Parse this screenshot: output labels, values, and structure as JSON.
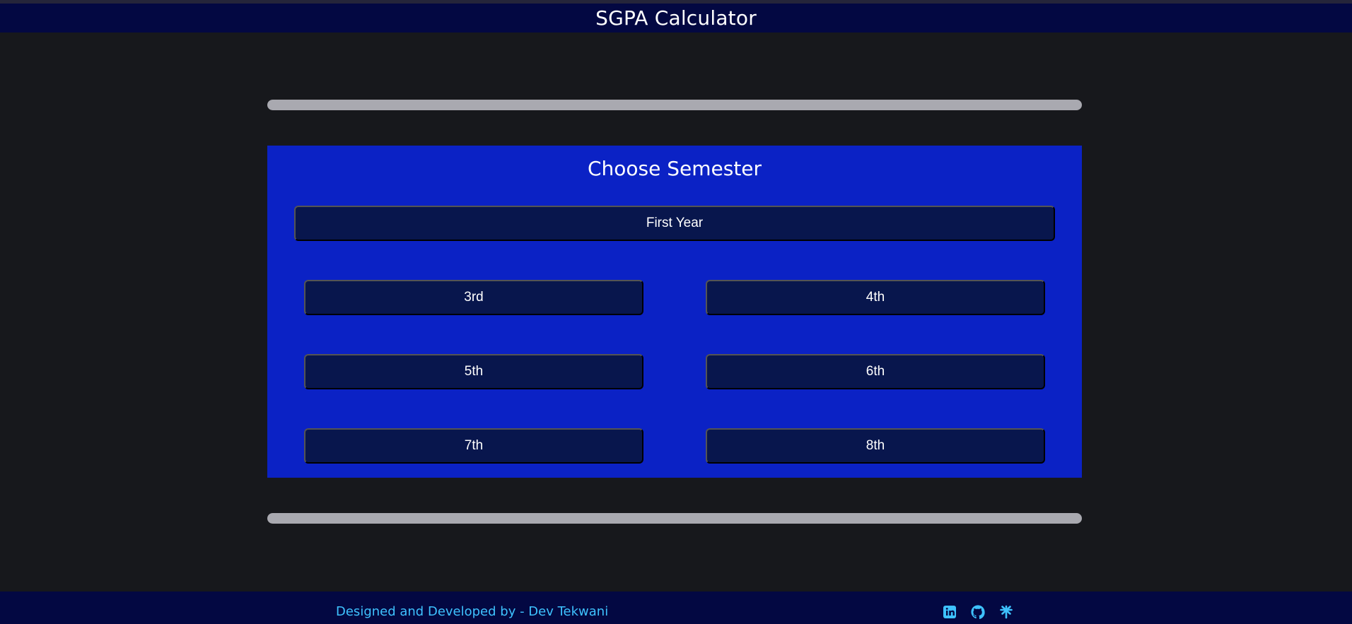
{
  "header": {
    "title": "SGPA Calculator"
  },
  "panel": {
    "title": "Choose Semester",
    "first_year": "First Year",
    "semesters": [
      "3rd",
      "4th",
      "5th",
      "6th",
      "7th",
      "8th"
    ]
  },
  "footer": {
    "credit": "Designed and Developed by - Dev Tekwani",
    "icons": [
      "linkedin-icon",
      "github-icon",
      "linktree-icon"
    ]
  },
  "colors": {
    "page_bg": "#17181c",
    "navbar_bg": "#030842",
    "panel_bg": "#0b22c5",
    "button_bg": "#08164d",
    "divider": "#a9a9b0",
    "accent": "#3ec2ff"
  }
}
